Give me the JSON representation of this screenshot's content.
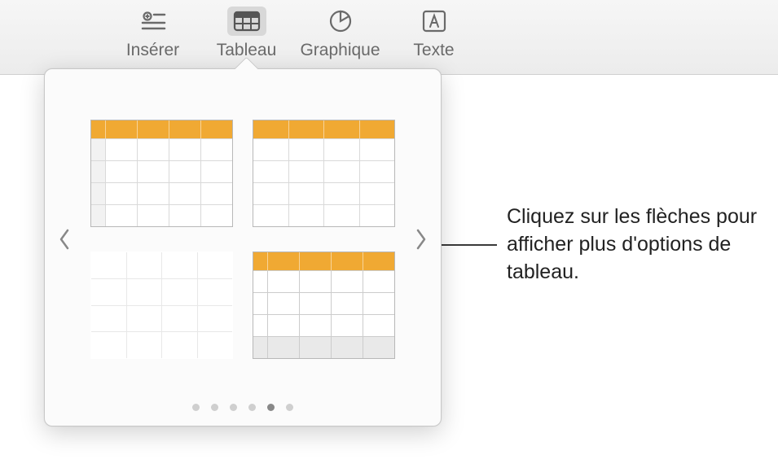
{
  "toolbar": {
    "items": [
      {
        "label": "Insérer",
        "icon": "insert-icon"
      },
      {
        "label": "Tableau",
        "icon": "table-icon",
        "active": true
      },
      {
        "label": "Graphique",
        "icon": "chart-icon"
      },
      {
        "label": "Texte",
        "icon": "text-icon"
      }
    ]
  },
  "popover": {
    "styles": [
      {
        "id": "style-header-rowhdr-orange",
        "accent": "#f0a933"
      },
      {
        "id": "style-header-orange",
        "accent": "#f0a933"
      },
      {
        "id": "style-plain-grid",
        "accent": null
      },
      {
        "id": "style-header-footer-orange",
        "accent": "#f0a933"
      }
    ],
    "nav": {
      "prev": "‹",
      "next": "›"
    },
    "pager": {
      "count": 6,
      "active_index": 4
    }
  },
  "callout": {
    "text": "Cliquez sur les flèches pour afficher plus d'options de tableau."
  },
  "colors": {
    "accent_orange": "#f0a933",
    "toolbar_bg": "#ececec"
  }
}
